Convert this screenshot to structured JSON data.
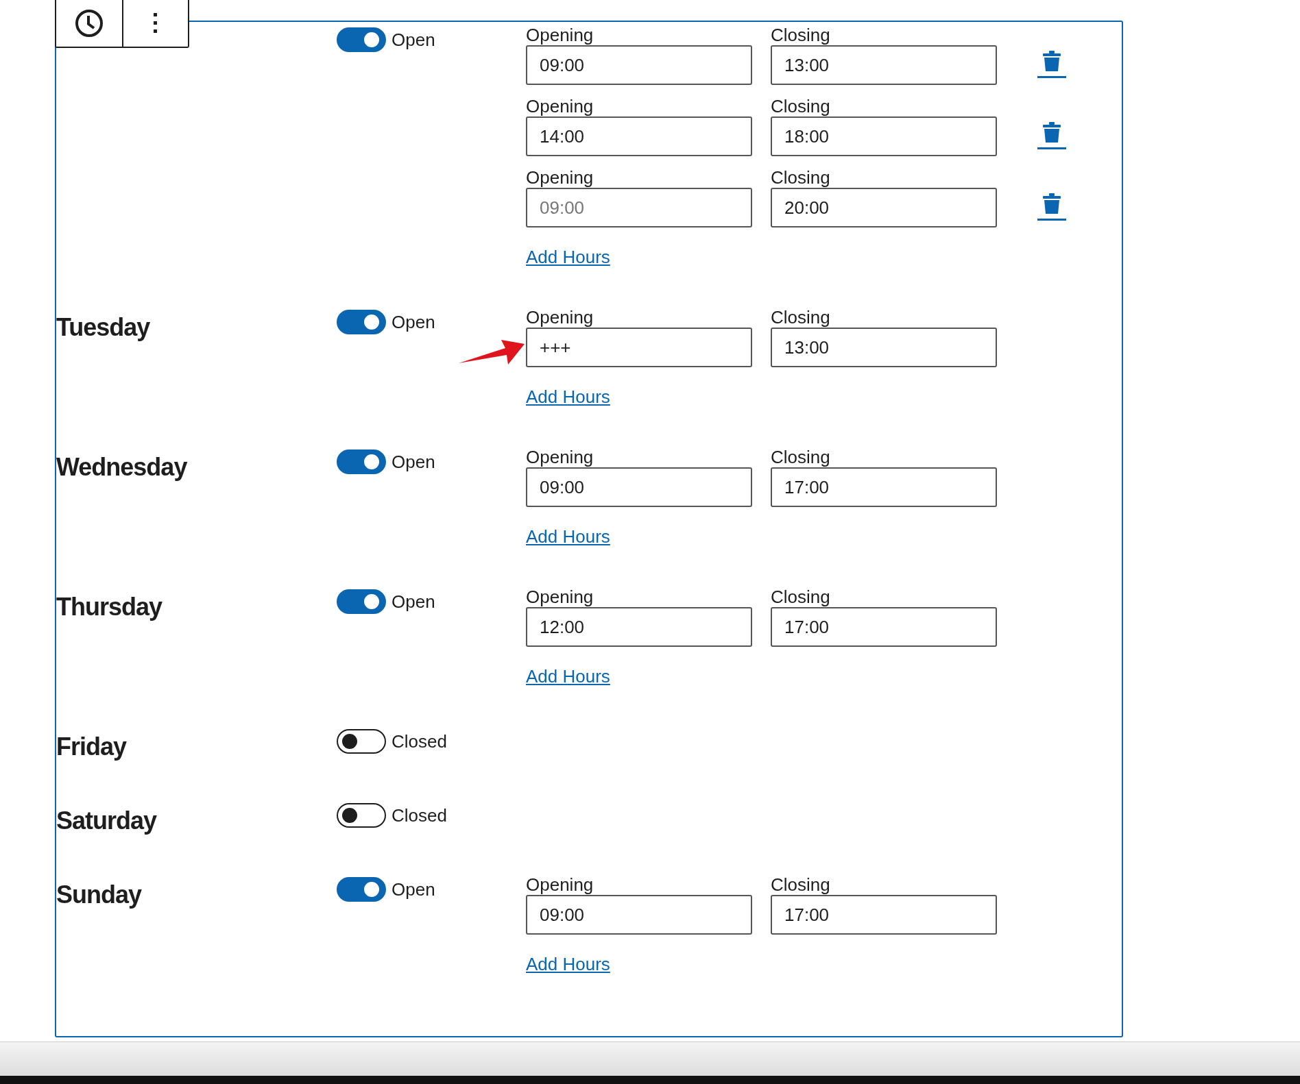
{
  "days": [
    {
      "open": true,
      "status": "Open",
      "hours": [
        {
          "opening_label": "Opening",
          "opening": {
            "value": "09:00"
          },
          "closing_label": "Closing",
          "closing": {
            "value": "13:00"
          },
          "removable": true
        },
        {
          "opening_label": "Opening",
          "opening": {
            "value": "14:00"
          },
          "closing_label": "Closing",
          "closing": {
            "value": "18:00"
          },
          "removable": true
        },
        {
          "opening_label": "Opening",
          "opening": {
            "placeholder": "09:00"
          },
          "closing_label": "Closing",
          "closing": {
            "value": "20:00"
          },
          "removable": true
        }
      ],
      "add_link": "Add Hours"
    },
    {
      "name": "Tuesday",
      "open": true,
      "status": "Open",
      "hours": [
        {
          "opening_label": "Opening",
          "opening": {
            "value": "+++"
          },
          "closing_label": "Closing",
          "closing": {
            "value": "13:00"
          },
          "removable": false,
          "annotated": true
        }
      ],
      "add_link": "Add Hours"
    },
    {
      "name": "Wednesday",
      "open": true,
      "status": "Open",
      "hours": [
        {
          "opening_label": "Opening",
          "opening": {
            "value": "09:00"
          },
          "closing_label": "Closing",
          "closing": {
            "value": "17:00"
          },
          "removable": false
        }
      ],
      "add_link": "Add Hours"
    },
    {
      "name": "Thursday",
      "open": true,
      "status": "Open",
      "hours": [
        {
          "opening_label": "Opening",
          "opening": {
            "value": "12:00"
          },
          "closing_label": "Closing",
          "closing": {
            "value": "17:00"
          },
          "removable": false
        }
      ],
      "add_link": "Add Hours"
    },
    {
      "name": "Friday",
      "open": false,
      "status": "Closed"
    },
    {
      "name": "Saturday",
      "open": false,
      "status": "Closed"
    },
    {
      "name": "Sunday",
      "open": true,
      "status": "Open",
      "hours": [
        {
          "opening_label": "Opening",
          "opening": {
            "value": "09:00"
          },
          "closing_label": "Closing",
          "closing": {
            "value": "17:00"
          },
          "removable": false
        }
      ],
      "add_link": "Add Hours"
    }
  ]
}
